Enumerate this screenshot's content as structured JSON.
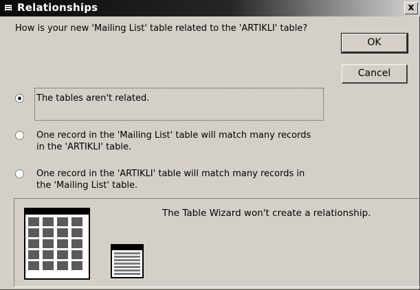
{
  "window": {
    "title": "Relationships",
    "close_label": "x"
  },
  "question": "How is your new 'Mailing List' table related to the 'ARTIKLI' table?",
  "buttons": {
    "ok": "OK",
    "cancel": "Cancel"
  },
  "options": [
    {
      "lines": [
        "The tables aren't related."
      ],
      "selected": true
    },
    {
      "lines": [
        "One record in the  'Mailing List' table will match many records",
        "in the 'ARTIKLI' table."
      ],
      "selected": false
    },
    {
      "lines": [
        "One record in the  'ARTIKLI' table will match many records in",
        "the 'Mailing List' table."
      ],
      "selected": false
    }
  ],
  "panel": {
    "description": "The Table Wizard won't create a relationship."
  },
  "icons": {
    "window": "table-icon",
    "preview_large": "table-grid-icon",
    "preview_small": "table-list-icon"
  }
}
